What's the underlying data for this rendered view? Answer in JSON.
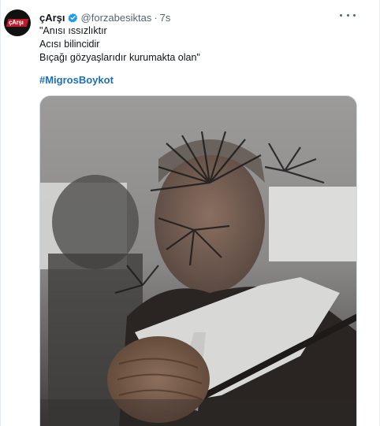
{
  "tweet": {
    "author_name": "çArşı",
    "handle": "@forzabesiktas",
    "separator": "·",
    "time": "7s",
    "lines": [
      "\"Anısı ıssızlıktır",
      "Acısı bilincidir",
      "Bıçağı gözyaşlarıdır kurumakta olan\""
    ],
    "hashtag": "#MigrosBoykot",
    "avatar_text": "çArşı"
  },
  "icons": {
    "verified": "verified-badge-icon",
    "more": "more-options-icon"
  },
  "colors": {
    "verified": "#1d9bf0",
    "hashtag": "#1d6fb8",
    "secondary_text": "#536471",
    "avatar_mark": "#c2192b"
  }
}
